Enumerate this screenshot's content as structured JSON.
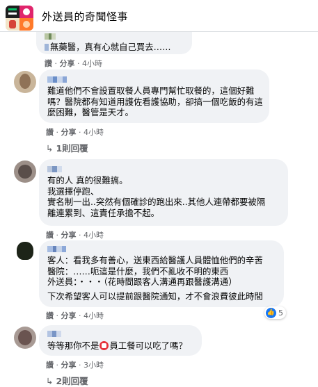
{
  "header": {
    "group_name": "外送員的奇聞怪事",
    "avatar_icon": "group-collage-icon"
  },
  "comments": [
    {
      "lines": [
        "無藥醫，真有心就自己買去……"
      ],
      "like_label": "讚",
      "share_label": "分享",
      "time": "4小時"
    },
    {
      "lines": [
        "難道他們不會設置取餐人員專門幫忙取餐的，這個好難",
        "嗎？醫院都有知道用護佐看護協助，卻搞一個吃飯的有這",
        "麼困難，醫管是天才。"
      ],
      "like_label": "讚",
      "share_label": "分享",
      "time": "4小時",
      "replies": "1則回覆"
    },
    {
      "lines": [
        "有的人 真的很難搞。",
        "我選擇停跑、",
        "實名制一出..突然有個確診的跑出來..其他人連帶都要被隔",
        "離連累到、這責任承擔不起。"
      ],
      "like_label": "讚",
      "share_label": "分享",
      "time": "4小時"
    },
    {
      "lines": [
        "客人：看我多有善心，送東西給醫護人員體恤他們的辛苦",
        "醫院：……呃這是什麼，我們不亂收不明的東西",
        "外送員：・・・（花時間跟客人溝通再跟醫護溝通）",
        "下次希望客人可以提前跟醫院通知，才不會浪費彼此時間"
      ],
      "like_label": "讚",
      "share_label": "分享",
      "time": "4小時",
      "reaction_count": "5"
    },
    {
      "line_before_icon": "等等那你不是",
      "line_after_icon": "員工餐可以吃了嗎？",
      "like_label": "讚",
      "share_label": "分享",
      "time": "3小時",
      "replies": "2則回覆"
    }
  ],
  "colors": {
    "bubble": "#f0f2f5",
    "meta_text": "#65676b",
    "like_blue": "#1877f2"
  }
}
